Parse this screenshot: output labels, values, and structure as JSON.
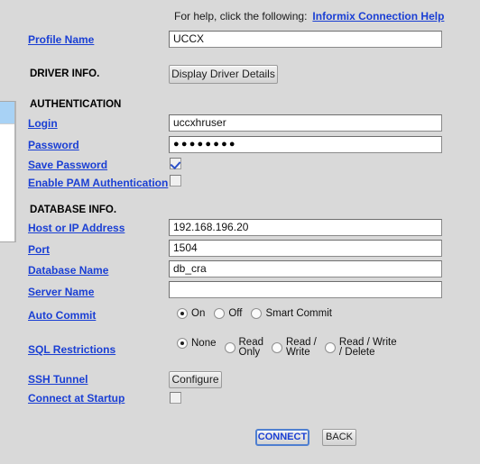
{
  "help": {
    "text": "For help, click the following:",
    "link_label": "Informix Connection Help"
  },
  "sections": {
    "driver_info": "DRIVER INFO.",
    "authentication": "AUTHENTICATION",
    "database_info": "DATABASE INFO."
  },
  "fields": {
    "profile_name": {
      "label": "Profile Name",
      "value": "UCCX"
    },
    "login": {
      "label": "Login",
      "value": "uccxhruser"
    },
    "password": {
      "label": "Password",
      "value": "●●●●●●●●"
    },
    "save_password": {
      "label": "Save Password",
      "checked": "true"
    },
    "enable_pam": {
      "label": "Enable PAM Authentication",
      "checked": "false"
    },
    "host_or_ip": {
      "label": "Host or IP Address",
      "value": "192.168.196.20"
    },
    "port": {
      "label": "Port",
      "value": "1504"
    },
    "database_name": {
      "label": "Database Name",
      "value": "db_cra"
    },
    "server_name": {
      "label": "Server Name",
      "value": ""
    },
    "auto_commit": {
      "label": "Auto Commit",
      "selected": "On"
    },
    "sql_restrictions": {
      "label": "SQL Restrictions",
      "selected": "None"
    },
    "ssh_tunnel": {
      "label": "SSH Tunnel"
    },
    "connect_at_startup": {
      "label": "Connect at Startup",
      "checked": "false"
    }
  },
  "auto_commit_options": [
    {
      "label": "On"
    },
    {
      "label": "Off"
    },
    {
      "label": "Smart Commit"
    }
  ],
  "sql_restrictions_options": [
    {
      "label": "None"
    },
    {
      "label": "Read\nOnly"
    },
    {
      "label": "Read /\nWrite"
    },
    {
      "label": "Read / Write\n/ Delete"
    }
  ],
  "buttons": {
    "driver_details": "Display Driver Details",
    "configure": "Configure",
    "connect": "CONNECT",
    "back": "BACK"
  },
  "colors": {
    "background": "#d9d9d9",
    "link": "#1a3fd4",
    "field_background": "#ffffff",
    "panel_header": "#a8d2f5"
  }
}
